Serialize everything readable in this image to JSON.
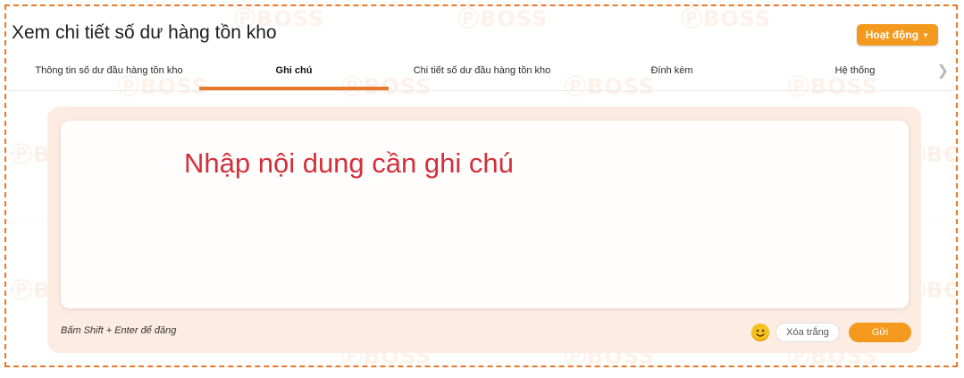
{
  "header": {
    "title": "Xem chi tiết số dư hàng tồn kho",
    "action_button": "Hoạt động"
  },
  "tabs": [
    {
      "label": "Thông tin số dư đầu hàng tồn kho",
      "active": false
    },
    {
      "label": "Ghi chú",
      "active": true
    },
    {
      "label": "Chi tiết số dư đầu hàng tồn kho",
      "active": false
    },
    {
      "label": "Đính kèm",
      "active": false
    },
    {
      "label": "Hệ thống",
      "active": false
    }
  ],
  "note": {
    "placeholder": "Nhập nội dung cần ghi chú",
    "hint": "Bấm Shift + Enter để đăng",
    "clear_label": "Xóa trắng",
    "send_label": "Gửi"
  },
  "watermark": {
    "text": "BOSS"
  },
  "icons": {
    "next": "chevron-right-icon",
    "emoji": "smiley-icon",
    "dropdown": "caret-down-icon"
  },
  "colors": {
    "accent": "#e8782a",
    "button": "#f39a1e",
    "placeholder_text": "#d42f3a",
    "panel_background": "#fdece2"
  }
}
